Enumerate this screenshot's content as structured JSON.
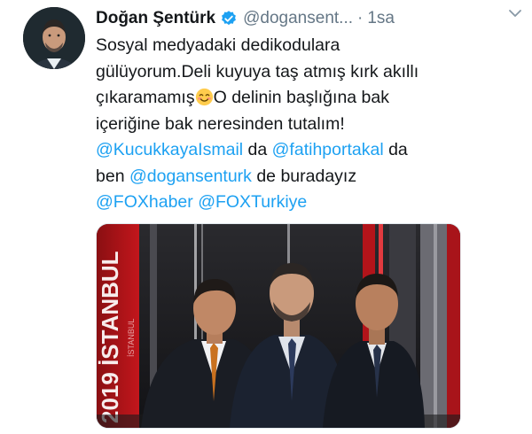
{
  "tweet": {
    "author": {
      "display_name": "Doğan Şentürk",
      "handle": "@dogansent...",
      "verified": true
    },
    "time_separator": "·",
    "time": "1sa",
    "text": {
      "line1": "Sosyal medyadaki dedikodulara",
      "line2": "gülüyorum.Deli kuyuya taş atmış kırk akıllı",
      "line3_before": "çıkaramamış",
      "line3_after": "O delinin başlığına bak",
      "line4": "içeriğine bak neresinden tutalım!",
      "mention1": "@KucukkayaIsmail",
      "word_da_1": " da ",
      "mention2": "@fatihportakal",
      "word_da_2": " da",
      "word_ben": "ben ",
      "mention3": "@dogansenturk",
      "word_rest": " de buradayız",
      "mention4": "@FOXhaber",
      "space": " ",
      "mention5": "@FOXTurkiye"
    },
    "media": {
      "backdrop_text_large": "2019 İSTANBUL",
      "backdrop_text_small": "İSTANBUL"
    }
  },
  "colors": {
    "link": "#1da1f2",
    "secondary": "#657786",
    "verified_badge": "#1da1f2"
  },
  "icons": [
    "verified-badge-icon",
    "chevron-down-icon",
    "smiling-face-emoji"
  ]
}
